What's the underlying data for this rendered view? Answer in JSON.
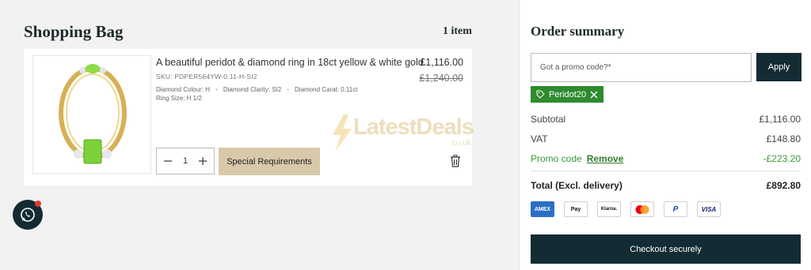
{
  "bag": {
    "title": "Shopping Bag",
    "count": "1 item",
    "item": {
      "name": "A beautiful peridot & diamond ring in 18ct yellow & white gold",
      "price": "£1,116.00",
      "old_price": "£1,240.00",
      "sku": "SKU: PDPER564YW-0.11-H-SI2",
      "colour": "Diamond Colour: H",
      "clarity": "Diamond Clarity: SI2",
      "carat": "Diamond Carat: 0.11ct",
      "ring_size": "Ring Size: H 1/2",
      "qty": "1",
      "special_label": "Special Requirements"
    }
  },
  "watermark": {
    "text": "LatestDeals",
    "sub": ".co.uk"
  },
  "summary": {
    "title": "Order summary",
    "promo_placeholder": "Got a promo code?*",
    "apply_label": "Apply",
    "applied_code": "Peridot20",
    "subtotal_label": "Subtotal",
    "subtotal": "£1,116.00",
    "vat_label": "VAT",
    "vat": "£148.80",
    "promo_label": "Promo code",
    "remove_label": "Remove",
    "promo_value": "-£223.20",
    "total_label": "Total (Excl. delivery)",
    "total": "£892.80",
    "payments": [
      "AMEX",
      "Pay",
      "Klarna.",
      "MC",
      "P",
      "VISA"
    ],
    "checkout_label": "Checkout securely"
  },
  "colors": {
    "dark": "#132b33",
    "beige": "#d8c9ab",
    "green": "#2e8b2e"
  }
}
